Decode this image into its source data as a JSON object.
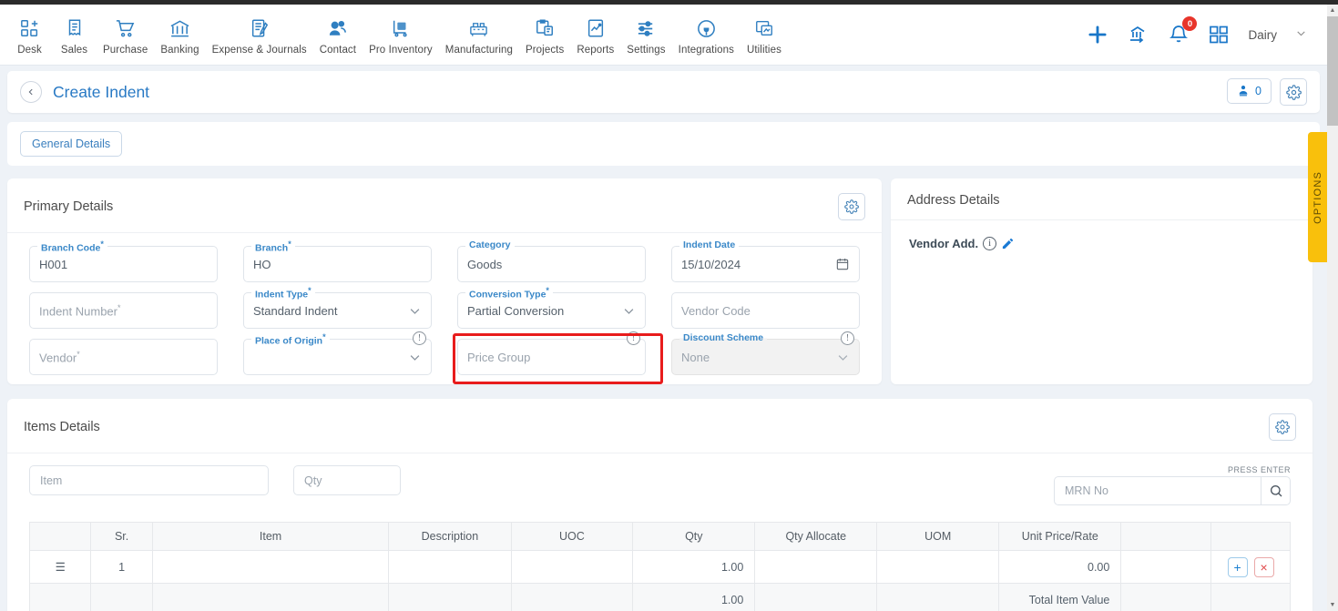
{
  "topnav": {
    "items": [
      {
        "label": "Desk",
        "icon": "desk-icon"
      },
      {
        "label": "Sales",
        "icon": "receipt-icon"
      },
      {
        "label": "Purchase",
        "icon": "cart-icon"
      },
      {
        "label": "Banking",
        "icon": "bank-icon"
      },
      {
        "label": "Expense & Journals",
        "icon": "journal-icon"
      },
      {
        "label": "Contact",
        "icon": "contacts-icon"
      },
      {
        "label": "Pro Inventory",
        "icon": "inventory-icon"
      },
      {
        "label": "Manufacturing",
        "icon": "factory-icon"
      },
      {
        "label": "Projects",
        "icon": "clipboard-icon"
      },
      {
        "label": "Reports",
        "icon": "chart-report-icon"
      },
      {
        "label": "Settings",
        "icon": "sliders-icon"
      },
      {
        "label": "Integrations",
        "icon": "plug-icon"
      },
      {
        "label": "Utilities",
        "icon": "utilities-icon"
      }
    ],
    "right": {
      "add_icon": "plus-icon",
      "import_icon": "bank-transfer-icon",
      "bell_icon": "bell-icon",
      "notification_count": "0",
      "apps_icon": "grid-apps-icon",
      "user": "Dairy",
      "caret": "⌄"
    }
  },
  "header": {
    "back_icon": "chevron-left-icon",
    "title": "Create Indent",
    "user_count": "0",
    "user_icon": "user-upload-icon",
    "settings_icon": "gear-icon"
  },
  "tabs": [
    {
      "label": "General Details"
    }
  ],
  "primary": {
    "title": "Primary Details",
    "settings_icon": "gear-icon",
    "fields": [
      {
        "label": "Branch Code",
        "required": true,
        "value": "H001",
        "placeholder": "",
        "type": "text"
      },
      {
        "label": "Branch",
        "required": true,
        "value": "HO",
        "placeholder": "",
        "type": "text"
      },
      {
        "label": "Category",
        "required": false,
        "value": "Goods",
        "placeholder": "",
        "type": "text"
      },
      {
        "label": "Indent Date",
        "required": false,
        "value": "15/10/2024",
        "placeholder": "",
        "type": "date",
        "icon": "calendar-icon"
      },
      {
        "label": "Indent Number",
        "required": true,
        "value": "",
        "placeholder": "Indent Number",
        "type": "text"
      },
      {
        "label": "Indent Type",
        "required": true,
        "value": "Standard Indent",
        "placeholder": "",
        "type": "select"
      },
      {
        "label": "Conversion Type",
        "required": true,
        "value": "Partial Conversion",
        "placeholder": "",
        "type": "select"
      },
      {
        "label": "Vendor Code",
        "required": false,
        "value": "",
        "placeholder": "Vendor Code",
        "type": "text"
      },
      {
        "label": "Vendor",
        "required": true,
        "value": "",
        "placeholder": "Vendor",
        "type": "text"
      },
      {
        "label": "Place of Origin",
        "required": true,
        "value": "",
        "placeholder": "",
        "type": "select",
        "info": true
      },
      {
        "label": "Price Group",
        "required": false,
        "value": "",
        "placeholder": "Price Group",
        "type": "text",
        "info": true,
        "highlighted": true
      },
      {
        "label": "Discount Scheme",
        "required": false,
        "value": "None",
        "placeholder": "",
        "type": "select",
        "info": true,
        "disabled": true
      }
    ]
  },
  "address": {
    "title": "Address Details",
    "vendor_add_label": "Vendor Add.",
    "info_icon": "info-icon",
    "edit_icon": "pencil-icon"
  },
  "items": {
    "title": "Items Details",
    "settings_icon": "gear-icon",
    "item_placeholder": "Item",
    "qty_placeholder": "Qty",
    "press_enter": "PRESS ENTER",
    "mrn_placeholder": "MRN No",
    "search_icon": "search-icon",
    "columns": [
      "",
      "Sr.",
      "Item",
      "Description",
      "UOC",
      "Qty",
      "Qty Allocate",
      "UOM",
      "Unit Price/Rate",
      "",
      ""
    ],
    "rows": [
      {
        "handle_icon": "drag-handle-icon",
        "sr": "1",
        "item": "",
        "description": "",
        "uoc": "",
        "qty": "1.00",
        "qty_allocate": "",
        "uom": "",
        "unit_price": "0.00",
        "blank": "",
        "add_icon": "plus-icon",
        "delete_icon": "close-icon"
      }
    ],
    "total_row": {
      "qty": "1.00",
      "label": "Total Item Value"
    }
  },
  "options_tab": {
    "label": "OPTIONS"
  },
  "colors": {
    "accent": "#1876c8",
    "label": "#3a88c8",
    "highlight": "#e81c1c",
    "options": "#f9c00c",
    "badge": "#e8352b"
  }
}
